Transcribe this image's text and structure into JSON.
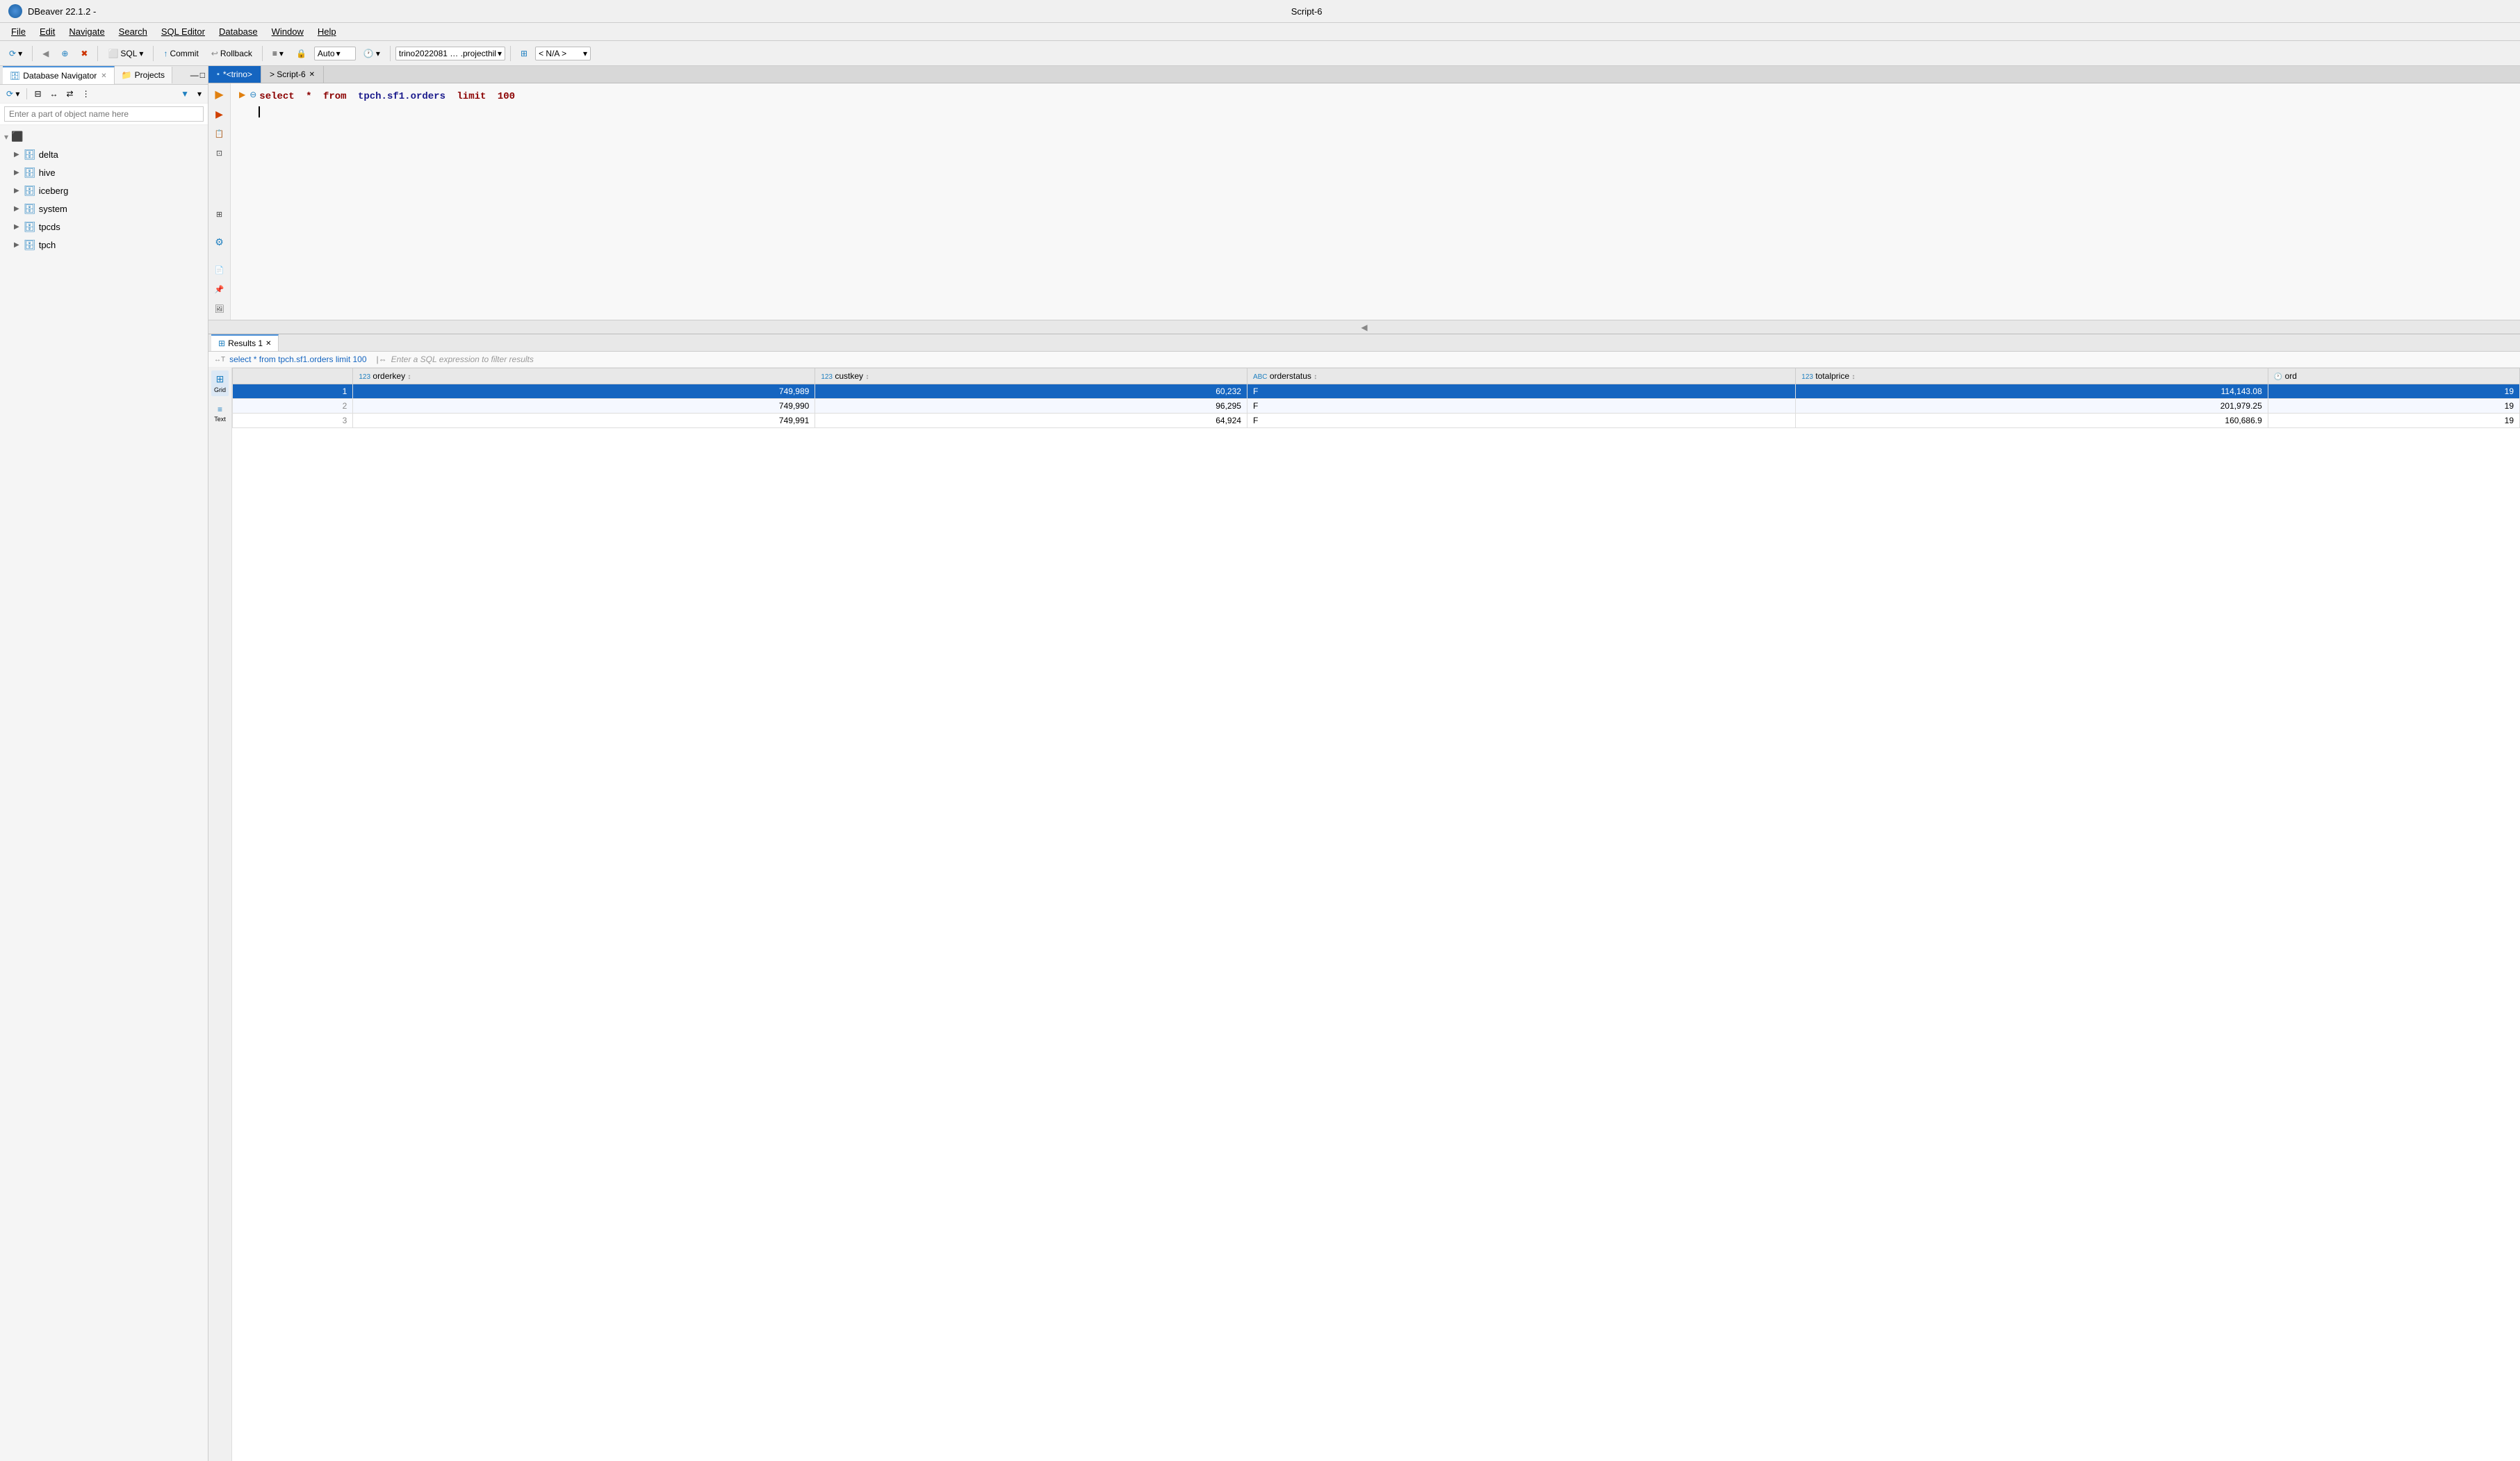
{
  "titlebar": {
    "app_name": "DBeaver 22.1.2 -",
    "script": "Script-6",
    "icon": "dbeaver-icon"
  },
  "menubar": {
    "items": [
      {
        "label": "File",
        "id": "file"
      },
      {
        "label": "Edit",
        "id": "edit"
      },
      {
        "label": "Navigate",
        "id": "navigate"
      },
      {
        "label": "Search",
        "id": "search"
      },
      {
        "label": "SQL Editor",
        "id": "sql-editor"
      },
      {
        "label": "Database",
        "id": "database"
      },
      {
        "label": "Window",
        "id": "window"
      },
      {
        "label": "Help",
        "id": "help"
      }
    ]
  },
  "toolbar": {
    "sql_label": "SQL",
    "commit_label": "Commit",
    "rollback_label": "Rollback",
    "auto_label": "Auto",
    "connection_label": "trino2022081 … .projecthil",
    "schema_label": "< N/A >"
  },
  "left_panel": {
    "tabs": [
      {
        "label": "Database Navigator",
        "active": true
      },
      {
        "label": "Projects",
        "active": false
      }
    ],
    "search_placeholder": "Enter a part of object name here",
    "tree": {
      "root_icon": "database-root",
      "items": [
        {
          "label": "delta",
          "icon": "database-icon",
          "expanded": false
        },
        {
          "label": "hive",
          "icon": "database-icon",
          "expanded": false
        },
        {
          "label": "iceberg",
          "icon": "database-icon",
          "expanded": false
        },
        {
          "label": "system",
          "icon": "database-icon",
          "expanded": false
        },
        {
          "label": "tpcds",
          "icon": "database-icon",
          "expanded": false
        },
        {
          "label": "tpch",
          "icon": "database-icon",
          "expanded": false
        }
      ]
    }
  },
  "editor": {
    "tabs": [
      {
        "label": "*<trino>",
        "active": true
      },
      {
        "label": "> Script-6",
        "active": false,
        "close": true
      }
    ],
    "code": "select * from tpch.sf1.orders limit 100"
  },
  "results": {
    "tab_label": "Results 1",
    "query_text": "select * from tpch.sf1.orders limit 100",
    "filter_placeholder": "Enter a SQL expression to filter results",
    "columns": [
      {
        "type": "123",
        "label": "orderkey",
        "sort": true
      },
      {
        "type": "123",
        "label": "custkey",
        "sort": true
      },
      {
        "type": "ABC",
        "label": "orderstatus",
        "sort": true
      },
      {
        "type": "123",
        "label": "totalprice",
        "sort": true
      },
      {
        "type": "clock",
        "label": "ord",
        "sort": false
      }
    ],
    "rows": [
      {
        "num": "1",
        "orderkey": "749,989",
        "custkey": "60,232",
        "orderstatus": "F",
        "totalprice": "114,143.08",
        "ord": "19",
        "selected": true
      },
      {
        "num": "2",
        "orderkey": "749,990",
        "custkey": "96,295",
        "orderstatus": "F",
        "totalprice": "201,979.25",
        "ord": "19",
        "selected": false
      },
      {
        "num": "3",
        "orderkey": "749,991",
        "custkey": "64,924",
        "orderstatus": "F",
        "totalprice": "160,686.9",
        "ord": "19",
        "selected": false
      }
    ]
  }
}
